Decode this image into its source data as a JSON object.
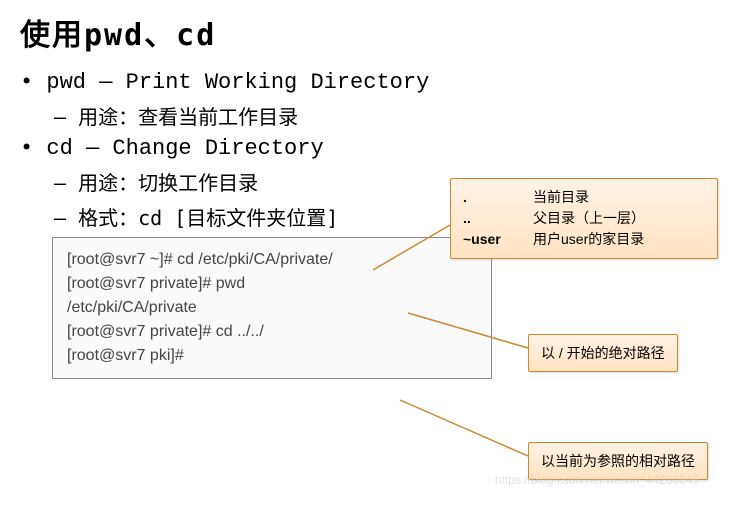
{
  "title": "使用pwd、cd",
  "items": [
    {
      "head": "pwd —  Print Working Directory",
      "subs": [
        "用途：查看当前工作目录"
      ]
    },
    {
      "head": "cd —  Change Directory",
      "subs": [
        "用途：切换工作目录",
        "格式：cd  [目标文件夹位置]"
      ]
    }
  ],
  "special_paths": [
    {
      "key": ".",
      "desc": "当前目录"
    },
    {
      "key": "..",
      "desc": "父目录（上一层）"
    },
    {
      "key": "~user",
      "desc": "用户user的家目录"
    }
  ],
  "terminal": [
    "[root@svr7 ~]# cd  /etc/pki/CA/private/",
    "[root@svr7 private]# pwd",
    "/etc/pki/CA/private",
    "[root@svr7 private]# cd  ../../",
    "[root@svr7 pki]#"
  ],
  "callout_abs": "以 / 开始的绝对路径",
  "callout_rel": "以当前为参照的相对路径",
  "watermark": "https://blog.csdn.net/weixin_44200645"
}
